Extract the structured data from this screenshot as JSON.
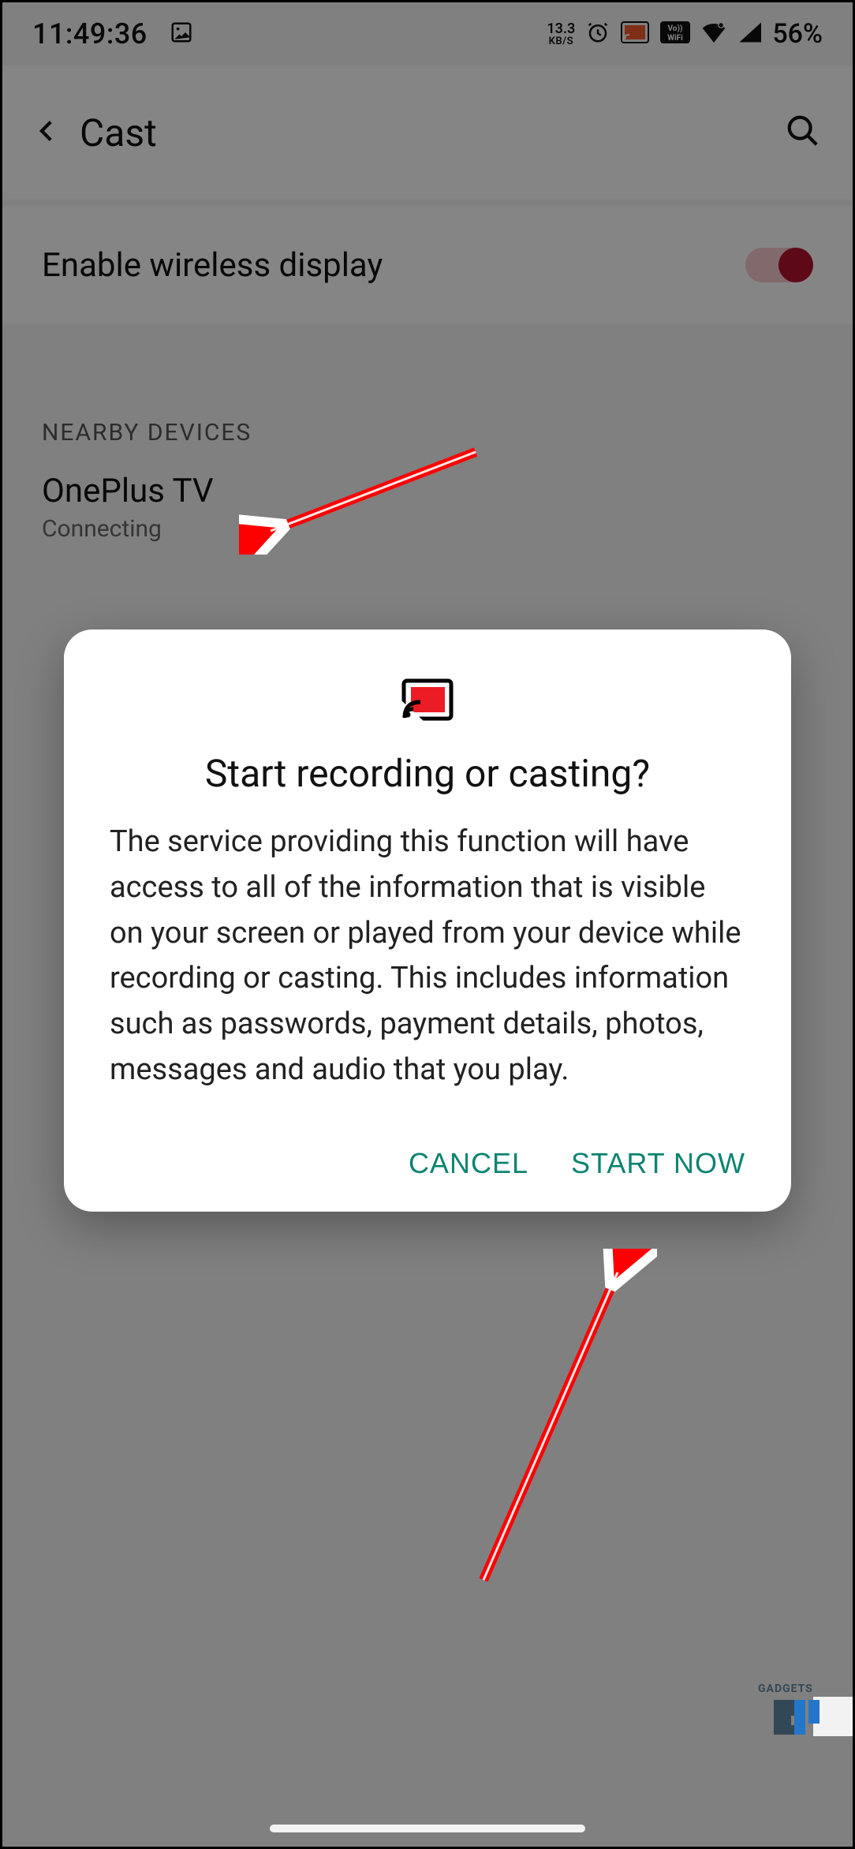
{
  "statusbar": {
    "time": "11:49:36",
    "net_speed_value": "13.3",
    "net_speed_unit": "KB/S",
    "battery_pct": "56%"
  },
  "header": {
    "title": "Cast"
  },
  "wireless": {
    "label": "Enable wireless display",
    "enabled": true
  },
  "section": {
    "title": "NEARBY DEVICES"
  },
  "devices": [
    {
      "name": "OnePlus TV",
      "status": "Connecting"
    }
  ],
  "dialog": {
    "title": "Start recording or casting?",
    "body": "The service providing this function will have access to all of the information that is visible on your screen or played from your device while recording or casting. This includes information such as passwords, payment details, photos, messages and audio that you play.",
    "cancel": "CANCEL",
    "confirm": "START NOW"
  },
  "watermark": "GADGETS"
}
